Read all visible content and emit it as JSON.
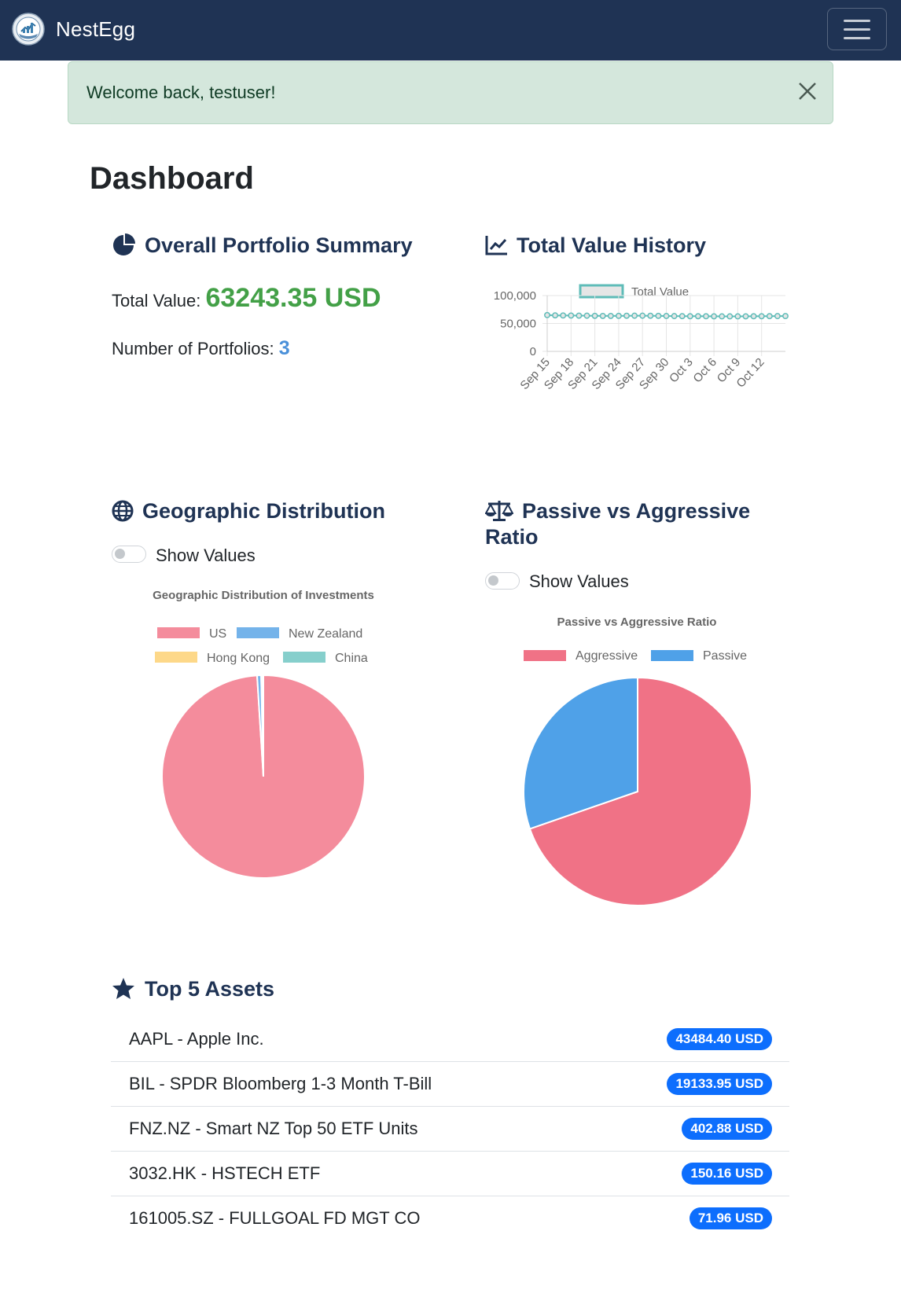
{
  "navbar": {
    "brand": "NestEgg",
    "logo_icon": "nest-egg-logo-icon",
    "menu_icon": "hamburger-menu-icon"
  },
  "alert": {
    "message": "Welcome back, testuser!",
    "close_icon": "close-icon"
  },
  "page": {
    "title": "Dashboard"
  },
  "summary": {
    "title": "Overall Portfolio Summary",
    "icon": "pie-chart-icon",
    "total_label": "Total Value:",
    "total_value": "63243.35 USD",
    "count_label": "Number of Portfolios:",
    "count_value": "3"
  },
  "history": {
    "title": "Total Value History",
    "icon": "line-chart-icon"
  },
  "geo": {
    "title": "Geographic Distribution",
    "icon": "globe-icon",
    "toggle_label": "Show Values"
  },
  "ratio": {
    "title_line1": "Passive vs Aggressive",
    "title_line2": "Ratio",
    "icon": "balance-scale-icon",
    "toggle_label": "Show Values"
  },
  "top_assets": {
    "title": "Top 5 Assets",
    "icon": "star-icon",
    "items": [
      {
        "name": "AAPL - Apple Inc.",
        "value": "43484.40 USD"
      },
      {
        "name": "BIL - SPDR Bloomberg 1-3 Month T-Bill",
        "value": "19133.95 USD"
      },
      {
        "name": "FNZ.NZ - Smart NZ Top 50 ETF Units",
        "value": "402.88 USD"
      },
      {
        "name": "3032.HK - HSTECH ETF",
        "value": "150.16 USD"
      },
      {
        "name": "161005.SZ - FULLGOAL FD MGT CO",
        "value": "71.96 USD"
      }
    ]
  },
  "colors": {
    "navbar": "#1f3354",
    "heading": "#1f3354",
    "total_value": "#43a047",
    "portfolio_count": "#4a90d9",
    "badge": "#0d6efd",
    "line": "#5fbcb8"
  },
  "chart_data": [
    {
      "type": "line",
      "legend": [
        "Total Value"
      ],
      "legend_position": "top",
      "x": [
        "Sep 15",
        "Sep 16",
        "Sep 17",
        "Sep 18",
        "Sep 19",
        "Sep 20",
        "Sep 21",
        "Sep 22",
        "Sep 23",
        "Sep 24",
        "Sep 25",
        "Sep 26",
        "Sep 27",
        "Sep 28",
        "Sep 29",
        "Sep 30",
        "Oct 1",
        "Oct 2",
        "Oct 3",
        "Oct 4",
        "Oct 5",
        "Oct 6",
        "Oct 7",
        "Oct 8",
        "Oct 9",
        "Oct 10",
        "Oct 11",
        "Oct 12",
        "Oct 13",
        "Oct 14",
        "Oct 15"
      ],
      "x_tick_labels": [
        "Sep 15",
        "Sep 18",
        "Sep 21",
        "Sep 24",
        "Sep 27",
        "Sep 30",
        "Oct 3",
        "Oct 6",
        "Oct 9",
        "Oct 12"
      ],
      "series": [
        {
          "name": "Total Value",
          "values": [
            65000,
            64500,
            64300,
            64200,
            64000,
            63900,
            63700,
            63500,
            63500,
            63600,
            63800,
            63900,
            63900,
            63800,
            63600,
            63400,
            63200,
            63100,
            63000,
            63000,
            62900,
            62800,
            62700,
            62700,
            62700,
            62800,
            62900,
            63000,
            63100,
            63200,
            63243
          ]
        }
      ],
      "y_ticks": [
        "0",
        "50,000",
        "100,000"
      ],
      "ylim": [
        0,
        100000
      ],
      "grid": true
    },
    {
      "type": "pie",
      "title": "Geographic Distribution of Investments",
      "legend_position": "top",
      "categories": [
        "US",
        "New Zealand",
        "Hong Kong",
        "China"
      ],
      "values": [
        62618.35,
        402.88,
        150.16,
        71.96
      ],
      "colors": [
        "#f48c9c",
        "#74b3ea",
        "#fdd889",
        "#86cfcc"
      ]
    },
    {
      "type": "pie",
      "title": "Passive vs Aggressive Ratio",
      "legend_position": "top",
      "categories": [
        "Aggressive",
        "Passive"
      ],
      "values": [
        69.7,
        30.3
      ],
      "colors": [
        "#f07286",
        "#4fa1e8"
      ]
    }
  ]
}
